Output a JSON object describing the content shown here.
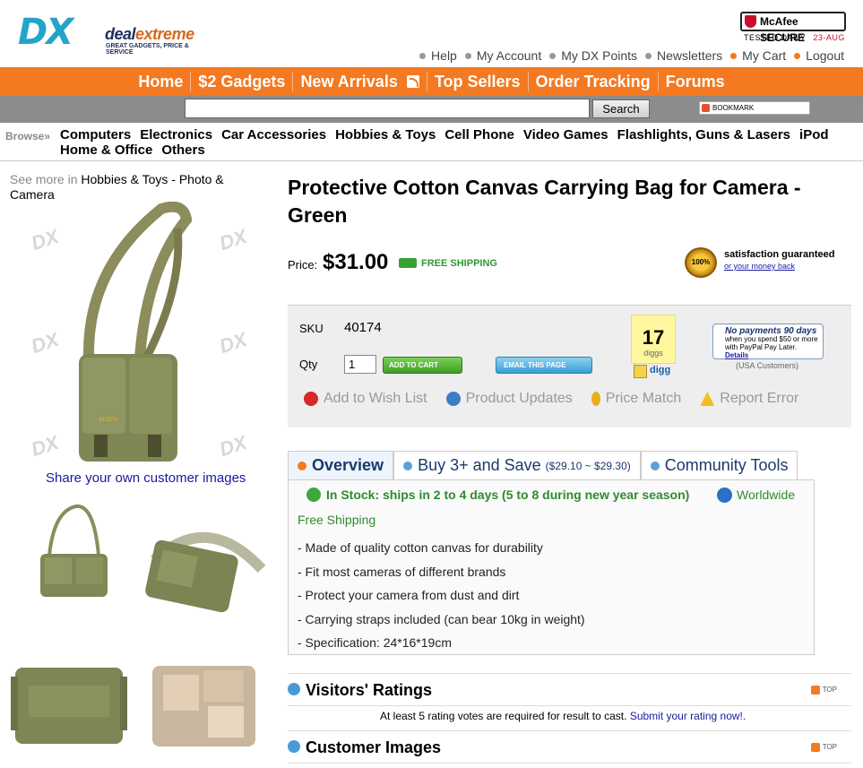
{
  "header": {
    "logo_dx": "DX",
    "logo_deal": "deal",
    "logo_extreme": "extreme",
    "logo_tagline": "GREAT GADGETS, PRICE & SERVICE",
    "mcafee_label": "McAfee SECURE",
    "mcafee_tested": "TESTED DAILY",
    "mcafee_date": "23-AUG",
    "top_links": [
      "Help",
      "My Account",
      "My DX Points",
      "Newsletters",
      "My Cart",
      "Logout"
    ]
  },
  "nav": {
    "items": [
      "Home",
      "$2 Gadgets",
      "New Arrivals",
      "Top Sellers",
      "Order Tracking",
      "Forums"
    ]
  },
  "search": {
    "value": "",
    "button": "Search",
    "bookmark": "BOOKMARK"
  },
  "browse": {
    "label": "Browse»",
    "categories": [
      "Computers",
      "Electronics",
      "Car Accessories",
      "Hobbies & Toys",
      "Cell Phone",
      "Video Games",
      "Flashlights, Guns & Lasers",
      "iPod",
      "Home & Office",
      "Others"
    ]
  },
  "left": {
    "see_more_prefix": "See more in",
    "see_more_link": "Hobbies & Toys - Photo & Camera",
    "watermark": "DX",
    "share_link": "Share your own customer images"
  },
  "product": {
    "title": "Protective Cotton Canvas Carrying Bag for Camera - Green",
    "price_label": "Price:",
    "price": "$31.00",
    "free_shipping_badge": "FREE SHIPPING",
    "seal_text": "100%",
    "satisfaction": "satisfaction guaranteed",
    "money_back": "or your money back",
    "sku_label": "SKU",
    "sku": "40174",
    "qty_label": "Qty",
    "qty": "1",
    "add_to_cart": "ADD TO CART",
    "email_page": "EMAIL THIS PAGE",
    "digg_count": "17",
    "digg_label": "diggs",
    "digg_button": "digg",
    "paypal_title": "No payments 90 days",
    "paypal_line": "when you spend $50 or more with PayPal Pay Later.",
    "paypal_details": "Details",
    "paypal_note": "(USA Customers)",
    "actions": [
      "Add to Wish List",
      "Product Updates",
      "Price Match",
      "Report Error"
    ]
  },
  "tabs": [
    {
      "label": "Overview",
      "sub": ""
    },
    {
      "label": "Buy 3+ and Save",
      "sub": "($29.10 ~ $29.30)"
    },
    {
      "label": "Community Tools",
      "sub": ""
    }
  ],
  "overview": {
    "stock": "In Stock: ships in 2 to 4 days (5 to 8 during new year season)",
    "worldwide": "Worldwide",
    "free_shipping": "Free Shipping",
    "bullets": [
      "- Made of quality cotton canvas for durability",
      "- Fit most cameras of different brands",
      "- Protect your camera from dust and dirt",
      "- Carrying straps included (can bear 10kg in weight)",
      "- Specification: 24*16*19cm"
    ]
  },
  "ratings": {
    "title": "Visitors' Ratings",
    "top": "TOP",
    "note": "At least 5 rating votes are required for result to cast.",
    "submit": "Submit your rating now!."
  },
  "customer_images": {
    "title": "Customer Images",
    "top": "TOP"
  }
}
